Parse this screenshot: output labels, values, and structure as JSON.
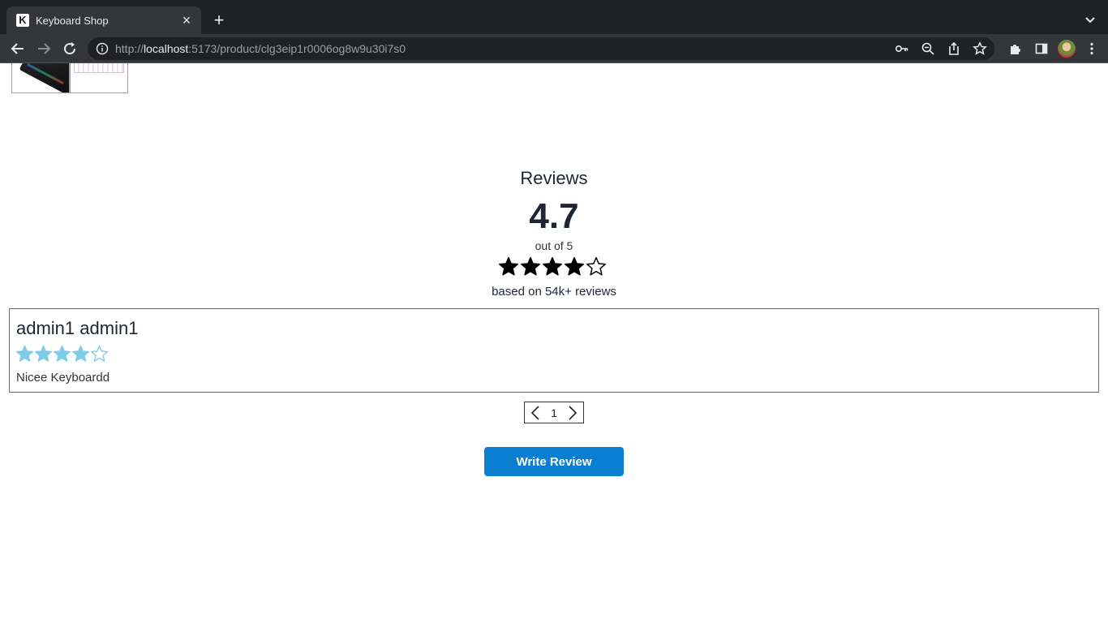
{
  "browser": {
    "tab_title": "Keyboard Shop",
    "favicon_letter": "K",
    "tab_close": "×",
    "new_tab": "+",
    "url_scheme_prefix": "http://",
    "url_host": "localhost",
    "url_path": ":5173/product/clg3eip1r0006og8w9u30i7s0"
  },
  "icons": {
    "back": "arrow-left-icon",
    "forward": "arrow-right-icon",
    "reload": "reload-icon",
    "info": "info-icon",
    "key": "key-icon",
    "zoom": "zoom-out-icon",
    "share": "share-icon",
    "star": "bookmark-star-icon",
    "extensions": "puzzle-icon",
    "side_panel": "side-panel-icon",
    "menu": "more-vert-icon"
  },
  "product": {
    "thumbnails": [
      "dark-keyboard-thumbnail",
      "white-rgb-keyboard-thumbnail"
    ]
  },
  "reviews": {
    "title": "Reviews",
    "average": "4.7",
    "out_of": "out of 5",
    "stars_filled": 4,
    "stars_total": 5,
    "based_on": "based on 54k+ reviews",
    "items": [
      {
        "author": "admin1 admin1",
        "stars_filled": 4,
        "stars_total": 5,
        "text": "Nicee Keyboardd"
      }
    ],
    "pagination": {
      "current_page": "1"
    },
    "write_button": "Write Review"
  },
  "colors": {
    "review_star": "#7fcbe8",
    "button_bg": "#0a7fd1",
    "chrome_dark": "#202124",
    "chrome_toolbar": "#35363a"
  }
}
